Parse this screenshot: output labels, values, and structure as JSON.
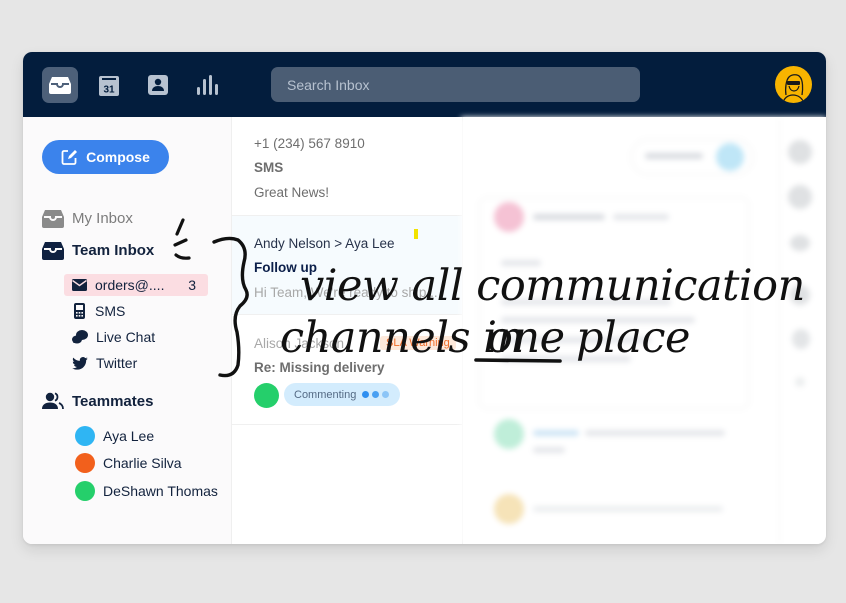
{
  "topbar": {
    "nav": [
      {
        "name": "inbox",
        "icon": "inbox-icon",
        "active": true
      },
      {
        "name": "calendar",
        "icon": "calendar-icon",
        "label": "31",
        "active": false
      },
      {
        "name": "contacts",
        "icon": "contact-icon",
        "active": false
      },
      {
        "name": "analytics",
        "icon": "bar-chart-icon",
        "active": false
      }
    ],
    "search_placeholder": "Search Inbox",
    "user_avatar": "user-avatar-icon",
    "avatar_color": "#f8b400"
  },
  "sidebar": {
    "compose_label": "Compose",
    "my_inbox_label": "My Inbox",
    "team_inbox_label": "Team Inbox",
    "channels": [
      {
        "label": "orders@....",
        "icon": "envelope-icon",
        "count": "3",
        "highlighted": true
      },
      {
        "label": "SMS",
        "icon": "phone-icon"
      },
      {
        "label": "Live Chat",
        "icon": "chat-bubbles-icon"
      },
      {
        "label": "Twitter",
        "icon": "twitter-icon"
      }
    ],
    "teammates_label": "Teammates",
    "teammates": [
      {
        "name": "Aya Lee",
        "color": "#2fb5f3"
      },
      {
        "name": "Charlie Silva",
        "color": "#f2601c"
      },
      {
        "name": "DeShawn Thomas",
        "color": "#25cf6b"
      }
    ]
  },
  "messages": [
    {
      "from": "+1 (234) 567 8910",
      "channel": "SMS",
      "preview": "Great News!"
    },
    {
      "from": "Andy Nelson > Aya Lee",
      "subject": "Follow up",
      "preview": "Hi Team, We're ready to ship..."
    },
    {
      "from": "Alison Jackson",
      "tag": "SLA Warning",
      "subject": "Re: Missing delivery",
      "status": "Commenting"
    }
  ],
  "colors": {
    "navy": "#031d3d",
    "accent_blue": "#3b83ec",
    "highlight_pink": "#fbdde2",
    "sla_orange": "#ef6d28",
    "commenting_blue": "#d3ecfd"
  },
  "annotation": {
    "line1": "view all communication",
    "line2_a": "channels in",
    "line2_b": "one",
    "line2_c": "place"
  }
}
